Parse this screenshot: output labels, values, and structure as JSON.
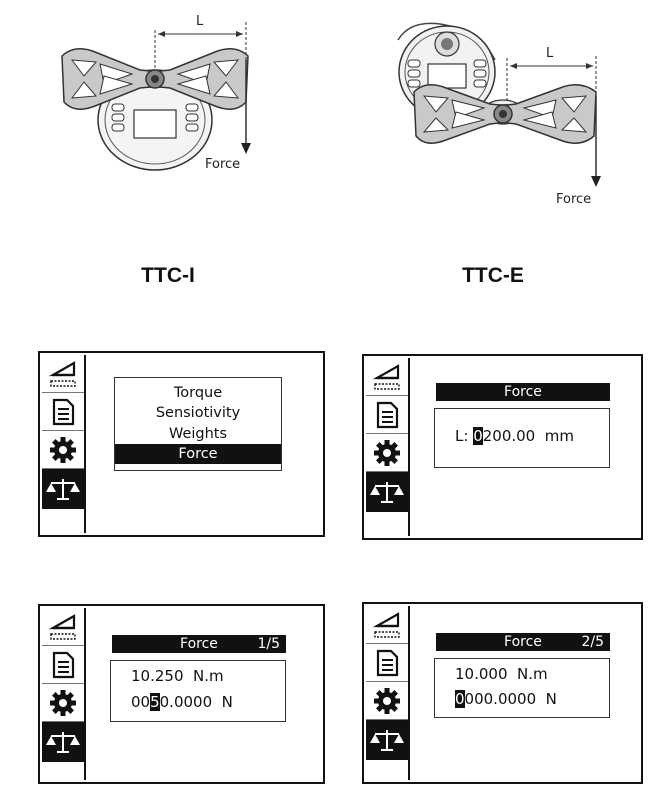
{
  "diagram": {
    "devices": [
      {
        "caption": "TTC-I",
        "dimension_label": "L",
        "force_label": "Force"
      },
      {
        "caption": "TTC-E",
        "dimension_label": "L",
        "force_label": "Force"
      }
    ]
  },
  "sidebar_icons": [
    "torque-wrench-icon",
    "document-icon",
    "gear-icon",
    "balance-scale-icon"
  ],
  "screens": [
    {
      "type": "menu",
      "menu_items": [
        "Torque",
        "Sensiotivity",
        "Weights",
        "Force"
      ],
      "selected_index": 3
    },
    {
      "type": "value",
      "title": "Force",
      "page": "",
      "lines": [
        {
          "prefix": "L: ",
          "cursor": "0",
          "suffix": "200.00  mm"
        }
      ]
    },
    {
      "type": "value",
      "title": "Force",
      "page": "1/5",
      "lines": [
        {
          "prefix": "10.250  N.m",
          "cursor": "",
          "suffix": ""
        },
        {
          "prefix": "00",
          "cursor": "5",
          "suffix": "0.0000  N"
        }
      ]
    },
    {
      "type": "value",
      "title": "Force",
      "page": "2/5",
      "lines": [
        {
          "prefix": "10.000  N.m",
          "cursor": "",
          "suffix": ""
        },
        {
          "prefix": "",
          "cursor": "0",
          "suffix": "000.0000  N"
        }
      ]
    }
  ]
}
